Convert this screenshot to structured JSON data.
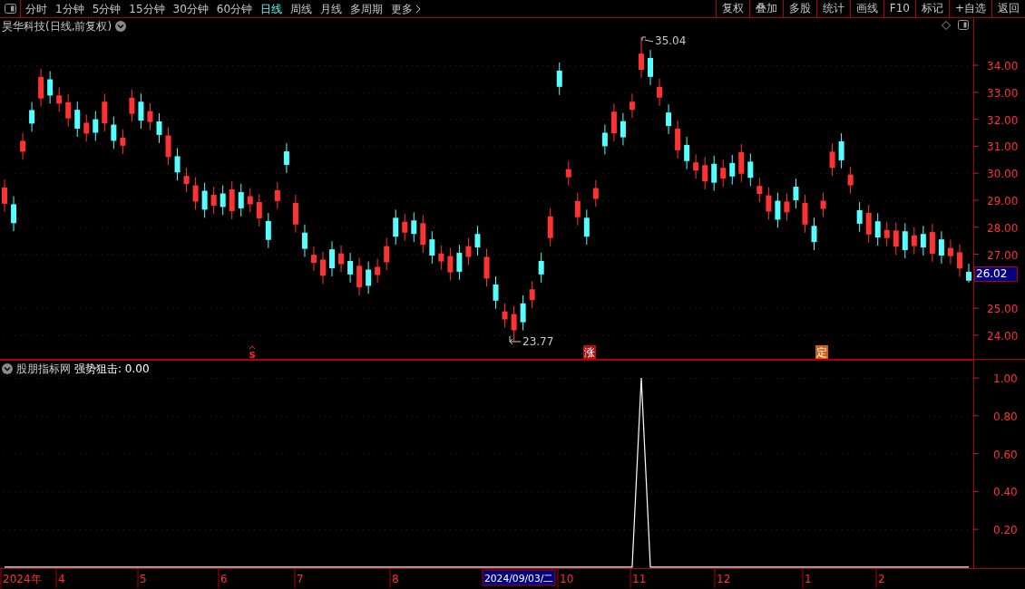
{
  "toolbar": {
    "periods": [
      {
        "label": "分时",
        "selected": false
      },
      {
        "label": "1分钟",
        "selected": false
      },
      {
        "label": "5分钟",
        "selected": false
      },
      {
        "label": "15分钟",
        "selected": false
      },
      {
        "label": "30分钟",
        "selected": false
      },
      {
        "label": "60分钟",
        "selected": false
      },
      {
        "label": "日线",
        "selected": true
      },
      {
        "label": "周线",
        "selected": false
      },
      {
        "label": "月线",
        "selected": false
      },
      {
        "label": "多周期",
        "selected": false
      },
      {
        "label": "更多",
        "selected": false
      }
    ],
    "actions": [
      "复权",
      "叠加",
      "多股",
      "统计",
      "画线",
      "F10",
      "标记",
      "+自选",
      "返回"
    ]
  },
  "main_chart": {
    "title": "昊华科技(日线,前复权)",
    "high_label": "35.04",
    "low_label": "23.77",
    "current_price": "26.02",
    "signals": [
      {
        "label": "s",
        "kind": "sell"
      },
      {
        "label": "涨",
        "kind": "rise"
      },
      {
        "label": "定",
        "kind": "fix"
      }
    ],
    "chart_data": {
      "type": "candlestick",
      "categories": [
        null,
        null,
        null,
        null,
        null,
        null,
        null,
        null,
        null,
        null,
        null,
        null,
        null,
        null,
        null,
        null,
        null,
        null,
        null,
        null,
        null,
        null,
        null,
        null,
        null,
        null,
        null,
        null,
        null,
        null,
        null,
        null,
        null,
        null,
        null,
        null,
        null,
        null,
        null,
        null,
        null,
        null,
        null,
        null,
        null,
        null,
        null,
        null,
        null,
        null,
        null,
        null,
        null,
        null,
        null,
        null,
        null,
        null,
        null,
        null,
        null,
        null,
        null,
        null,
        null,
        null,
        null,
        null,
        null,
        null,
        null,
        null,
        null,
        null,
        null,
        null,
        null,
        null,
        null,
        null,
        null,
        null,
        null,
        null,
        null,
        null,
        null,
        null,
        null,
        null,
        null,
        null,
        null,
        null,
        null,
        null,
        null,
        null,
        null,
        null,
        null,
        null,
        null,
        null,
        null,
        null,
        null
      ],
      "ohlc": [
        [
          28.87,
          29.77,
          28.57,
          29.47
        ],
        [
          28.85,
          29.15,
          27.85,
          28.15
        ],
        [
          30.8,
          31.5,
          30.5,
          31.2
        ],
        [
          32.34,
          32.64,
          31.54,
          31.84
        ],
        [
          32.77,
          33.87,
          32.47,
          33.57
        ],
        [
          33.48,
          33.78,
          32.58,
          32.88
        ],
        [
          32.58,
          33.18,
          32.28,
          32.88
        ],
        [
          32.03,
          32.93,
          31.73,
          32.63
        ],
        [
          32.35,
          32.65,
          31.35,
          31.65
        ],
        [
          31.47,
          32.17,
          31.17,
          31.87
        ],
        [
          32.0,
          32.3,
          31.2,
          31.5
        ],
        [
          31.85,
          32.95,
          31.55,
          32.65
        ],
        [
          31.8,
          32.1,
          30.9,
          31.2
        ],
        [
          31.02,
          31.62,
          30.72,
          31.32
        ],
        [
          32.2,
          33.1,
          31.9,
          32.8
        ],
        [
          32.65,
          32.95,
          31.65,
          31.95
        ],
        [
          31.9,
          32.6,
          31.6,
          32.3
        ],
        [
          31.92,
          32.22,
          31.12,
          31.42
        ],
        [
          30.6,
          31.7,
          30.3,
          31.4
        ],
        [
          30.63,
          30.93,
          29.73,
          30.03
        ],
        [
          29.6,
          30.2,
          29.3,
          29.9
        ],
        [
          28.95,
          29.85,
          28.65,
          29.55
        ],
        [
          29.35,
          29.65,
          28.35,
          28.65
        ],
        [
          28.8,
          29.5,
          28.5,
          29.2
        ],
        [
          29.25,
          29.55,
          28.45,
          28.75
        ],
        [
          28.6,
          29.7,
          28.3,
          29.4
        ],
        [
          29.3,
          29.6,
          28.4,
          28.7
        ],
        [
          28.85,
          29.45,
          28.55,
          29.15
        ],
        [
          28.33,
          29.23,
          28.03,
          28.93
        ],
        [
          28.23,
          28.53,
          27.23,
          27.53
        ],
        [
          28.97,
          29.67,
          28.67,
          29.37
        ],
        [
          30.81,
          31.11,
          30.01,
          30.31
        ],
        [
          28.1,
          29.2,
          27.8,
          28.9
        ],
        [
          27.8,
          28.1,
          26.9,
          27.2
        ],
        [
          26.68,
          27.28,
          26.38,
          26.98
        ],
        [
          26.2,
          27.1,
          25.9,
          26.8
        ],
        [
          27.18,
          27.48,
          26.18,
          26.48
        ],
        [
          26.63,
          27.33,
          26.33,
          27.03
        ],
        [
          26.75,
          27.05,
          25.95,
          26.25
        ],
        [
          25.77,
          26.87,
          25.47,
          26.57
        ],
        [
          26.43,
          26.73,
          25.53,
          25.83
        ],
        [
          26.23,
          26.83,
          25.93,
          26.53
        ],
        [
          26.7,
          27.6,
          26.4,
          27.3
        ],
        [
          28.35,
          28.65,
          27.35,
          27.65
        ],
        [
          27.8,
          28.5,
          27.5,
          28.2
        ],
        [
          28.25,
          28.55,
          27.45,
          27.75
        ],
        [
          27.35,
          28.45,
          27.05,
          28.15
        ],
        [
          27.55,
          27.85,
          26.65,
          26.95
        ],
        [
          26.73,
          27.33,
          26.43,
          27.03
        ],
        [
          26.33,
          27.23,
          26.03,
          26.93
        ],
        [
          27.05,
          27.35,
          26.05,
          26.35
        ],
        [
          26.9,
          27.6,
          26.6,
          27.3
        ],
        [
          27.75,
          28.05,
          26.95,
          27.25
        ],
        [
          26.1,
          27.2,
          25.8,
          26.9
        ],
        [
          25.88,
          26.18,
          24.98,
          25.28
        ],
        [
          24.58,
          25.18,
          24.28,
          24.88
        ],
        [
          24.18,
          25.08,
          23.77,
          24.78
        ],
        [
          25.18,
          25.48,
          24.18,
          24.48
        ],
        [
          25.3,
          26.0,
          25.0,
          25.7
        ],
        [
          26.75,
          27.05,
          25.95,
          26.25
        ],
        [
          27.6,
          28.7,
          27.3,
          28.4
        ],
        [
          33.8,
          34.1,
          32.9,
          33.2
        ],
        [
          29.85,
          30.45,
          29.55,
          30.15
        ],
        [
          28.37,
          29.27,
          28.07,
          28.97
        ],
        [
          28.35,
          28.65,
          27.35,
          27.65
        ],
        [
          29.05,
          29.75,
          28.75,
          29.45
        ],
        [
          31.5,
          31.8,
          30.7,
          31.0
        ],
        [
          31.48,
          32.58,
          31.18,
          32.28
        ],
        [
          31.93,
          32.23,
          31.03,
          31.33
        ],
        [
          32.35,
          32.95,
          32.05,
          32.65
        ],
        [
          33.83,
          35.04,
          33.53,
          34.43
        ],
        [
          34.27,
          34.57,
          33.27,
          33.57
        ],
        [
          32.8,
          33.5,
          32.5,
          33.2
        ],
        [
          32.25,
          32.55,
          31.45,
          31.75
        ],
        [
          30.85,
          31.95,
          30.55,
          31.65
        ],
        [
          31.05,
          31.35,
          30.15,
          30.45
        ],
        [
          30.1,
          30.7,
          29.8,
          30.4
        ],
        [
          29.7,
          30.6,
          29.4,
          30.3
        ],
        [
          30.35,
          30.65,
          29.35,
          29.65
        ],
        [
          29.8,
          30.5,
          29.5,
          30.2
        ],
        [
          30.38,
          30.68,
          29.58,
          29.88
        ],
        [
          29.98,
          31.08,
          29.68,
          30.78
        ],
        [
          30.43,
          30.73,
          29.53,
          29.83
        ],
        [
          29.23,
          29.83,
          28.93,
          29.53
        ],
        [
          28.58,
          29.48,
          28.28,
          29.18
        ],
        [
          28.98,
          29.28,
          27.98,
          28.28
        ],
        [
          28.55,
          29.25,
          28.25,
          28.95
        ],
        [
          29.5,
          29.8,
          28.7,
          29.0
        ],
        [
          28.1,
          29.2,
          27.8,
          28.9
        ],
        [
          28.05,
          28.35,
          27.15,
          27.45
        ],
        [
          28.68,
          29.28,
          28.38,
          28.98
        ],
        [
          30.2,
          31.1,
          29.9,
          30.8
        ],
        [
          31.18,
          31.48,
          30.18,
          30.48
        ],
        [
          29.55,
          30.25,
          29.25,
          29.95
        ],
        [
          28.63,
          28.93,
          27.83,
          28.13
        ],
        [
          27.73,
          28.83,
          27.43,
          28.53
        ],
        [
          28.22,
          28.52,
          27.32,
          27.62
        ],
        [
          27.6,
          28.2,
          27.3,
          27.9
        ],
        [
          27.28,
          28.18,
          26.98,
          27.88
        ],
        [
          27.85,
          28.15,
          26.85,
          27.15
        ],
        [
          27.3,
          28.0,
          27.0,
          27.7
        ],
        [
          27.75,
          28.05,
          26.95,
          27.25
        ],
        [
          27.02,
          28.12,
          26.72,
          27.82
        ],
        [
          27.55,
          27.85,
          26.65,
          26.95
        ],
        [
          26.93,
          27.53,
          26.63,
          27.23
        ],
        [
          26.47,
          27.37,
          26.17,
          27.07
        ],
        [
          26.35,
          26.65,
          25.95,
          26.02
        ]
      ],
      "ylim": [
        23.09,
        35.78
      ],
      "yticks": [
        {
          "value": 34,
          "label": "34.00"
        },
        {
          "value": 33,
          "label": "33.00"
        },
        {
          "value": 32,
          "label": "32.00"
        },
        {
          "value": 31,
          "label": "31.00"
        },
        {
          "value": 30,
          "label": "30.00"
        },
        {
          "value": 29,
          "label": "29.00"
        },
        {
          "value": 28,
          "label": "28.00"
        },
        {
          "value": 27,
          "label": "27.00"
        },
        {
          "value": 25,
          "label": "25.00"
        },
        {
          "value": 24,
          "label": "24.00"
        }
      ]
    }
  },
  "indicator": {
    "title": "股朋指标网",
    "value_text": "强势狙击: 0.00",
    "chart_data": {
      "type": "line",
      "categories": [
        null,
        null,
        null,
        null,
        null,
        null,
        null,
        null,
        null,
        null,
        null,
        null,
        null,
        null,
        null,
        null,
        null,
        null,
        null,
        null,
        null,
        null,
        null,
        null,
        null,
        null,
        null,
        null,
        null,
        null,
        null,
        null,
        null,
        null,
        null,
        null,
        null,
        null,
        null,
        null,
        null,
        null,
        null,
        null,
        null,
        null,
        null,
        null,
        null,
        null,
        null,
        null,
        null,
        null,
        null,
        null,
        null,
        null,
        null,
        null,
        null,
        null,
        null,
        null,
        null,
        null,
        null,
        null,
        null,
        null,
        null,
        null,
        null,
        null,
        null,
        null,
        null,
        null,
        null,
        null,
        null,
        null,
        null,
        null,
        null,
        null,
        null,
        null,
        null,
        null,
        null,
        null,
        null,
        null,
        null,
        null,
        null,
        null,
        null,
        null,
        null,
        null,
        null,
        null,
        null,
        null,
        null
      ],
      "series": [
        {
          "color": "#ffffff",
          "values": [
            0,
            0,
            0,
            0,
            0,
            0,
            0,
            0,
            0,
            0,
            0,
            0,
            0,
            0,
            0,
            0,
            0,
            0,
            0,
            0,
            0,
            0,
            0,
            0,
            0,
            0,
            0,
            0,
            0,
            0,
            0,
            0,
            0,
            0,
            0,
            0,
            0,
            0,
            0,
            0,
            0,
            0,
            0,
            0,
            0,
            0,
            0,
            0,
            0,
            0,
            0,
            0,
            0,
            0,
            0,
            0,
            0,
            0,
            0,
            0,
            0,
            0,
            0,
            0,
            0,
            0,
            0,
            0,
            0,
            0,
            1,
            0,
            0,
            0,
            0,
            0,
            0,
            0,
            0,
            0,
            0,
            0,
            0,
            0,
            0,
            0,
            0,
            0,
            0,
            0,
            0,
            0,
            0,
            0,
            0,
            0,
            0,
            0,
            0,
            0,
            0,
            0,
            0,
            0,
            0,
            0,
            0
          ]
        }
      ],
      "ylim": [
        -0.01,
        1.096
      ],
      "yticks": [
        {
          "value": 1,
          "label": "1.00"
        },
        {
          "value": 0.8,
          "label": "0.80"
        },
        {
          "value": 0.6,
          "label": "0.60"
        },
        {
          "value": 0.4,
          "label": "0.40"
        },
        {
          "value": 0.2,
          "label": "0.20"
        }
      ]
    }
  },
  "time_axis": {
    "labels": [
      "2024年",
      "4",
      "5",
      "6",
      "7",
      "8",
      "10",
      "11",
      "12",
      "1",
      "2"
    ],
    "cursor_date": "2024/09/03/二"
  }
}
